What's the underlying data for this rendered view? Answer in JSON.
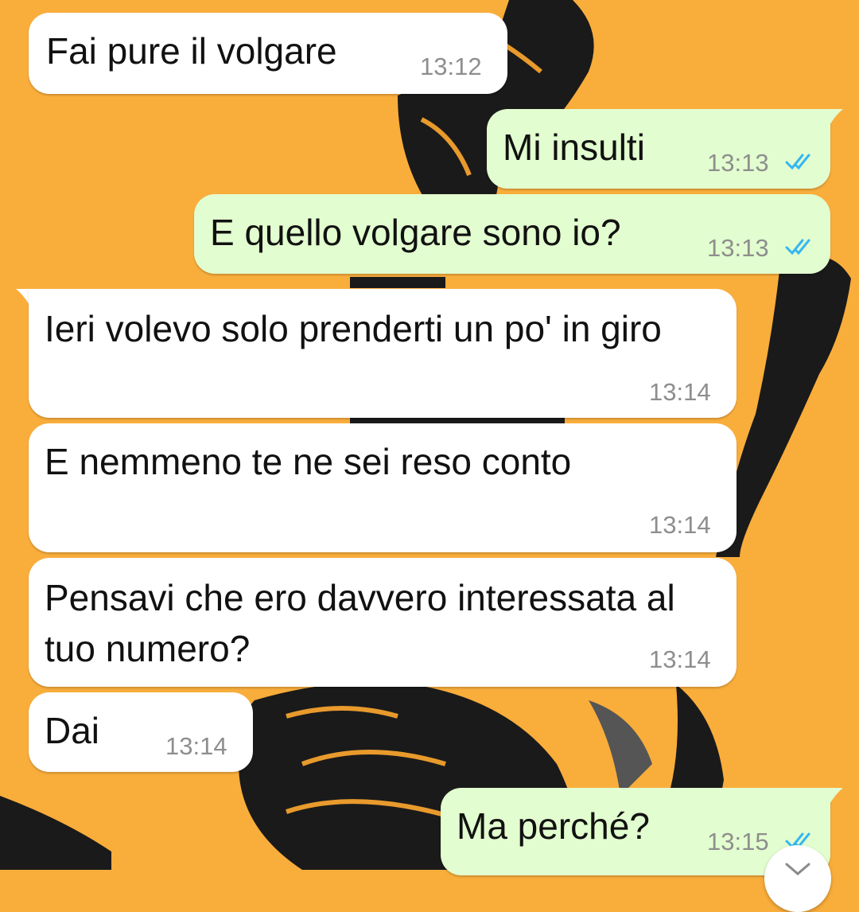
{
  "chat": {
    "colors": {
      "wallpaper": "#f9ad3b",
      "incoming_bubble": "#ffffff",
      "outgoing_bubble": "#e2fdcf",
      "read_ticks": "#34b7f1",
      "timestamp": "#8e8e8e"
    },
    "messages": [
      {
        "direction": "in",
        "text": "Fai pure il volgare",
        "time": "13:12"
      },
      {
        "direction": "out",
        "text": "Mi insulti",
        "time": "13:13",
        "status": "read"
      },
      {
        "direction": "out",
        "text": "E quello volgare sono io?",
        "time": "13:13",
        "status": "read"
      },
      {
        "direction": "in",
        "text": "Ieri volevo solo prenderti un po' in giro",
        "time": "13:14"
      },
      {
        "direction": "in",
        "text": "E nemmeno te ne sei reso conto",
        "time": "13:14"
      },
      {
        "direction": "in",
        "text": "Pensavi che ero davvero interessata al tuo numero?",
        "time": "13:14"
      },
      {
        "direction": "in",
        "text": "Dai",
        "time": "13:14"
      },
      {
        "direction": "out",
        "text": "Ma perché?",
        "time": "13:15",
        "status": "read"
      }
    ],
    "scroll_down_button": {
      "icon": "chevron-down-icon"
    }
  }
}
